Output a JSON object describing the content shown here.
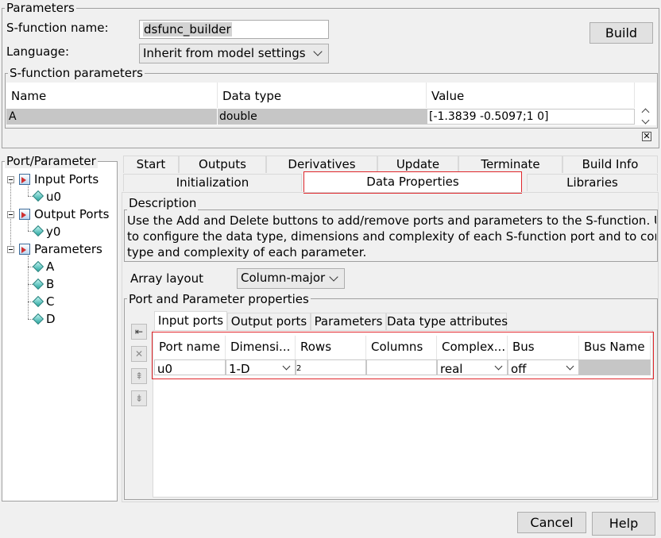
{
  "parameters_group": {
    "title": "Parameters",
    "sfunction_name_label": "S-function name:",
    "sfunction_name_value": "dsfunc_builder",
    "language_label": "Language:",
    "language_value": "Inherit from model settings",
    "build_label": "Build"
  },
  "sfunction_params": {
    "title": "S-function parameters",
    "columns": [
      "Name",
      "Data type",
      "Value"
    ],
    "rows": [
      {
        "name": "A",
        "data_type": "double",
        "value": "[-1.3839 -0.5097;1 0]"
      }
    ]
  },
  "port_tree": {
    "title": "Port/Parameter",
    "input_ports_label": "Input Ports",
    "input_ports": [
      "u0"
    ],
    "output_ports_label": "Output Ports",
    "output_ports": [
      "y0"
    ],
    "parameters_label": "Parameters",
    "parameters": [
      "A",
      "B",
      "C",
      "D"
    ]
  },
  "tabs": {
    "row1": [
      "Start",
      "Outputs",
      "Derivatives",
      "Update",
      "Terminate",
      "Build Info"
    ],
    "row2": [
      "Initialization",
      "Data Properties",
      "Libraries"
    ],
    "selected": "Data Properties"
  },
  "description": {
    "title": "Description",
    "lines": [
      "Use the Add and Delete buttons to add/remove ports and parameters to the S-function. Use",
      "to configure the data type, dimensions and complexity of each S-function port and to config",
      "type and complexity of each parameter."
    ]
  },
  "array_layout": {
    "label": "Array layout",
    "value": "Column-major"
  },
  "pp_properties": {
    "title": "Port and Parameter properties",
    "subtabs": [
      "Input ports",
      "Output ports",
      "Parameters",
      "Data type attributes"
    ],
    "columns": [
      "Port name",
      "Dimensi...",
      "Rows",
      "Columns",
      "Complex...",
      "Bus",
      "Bus Name"
    ],
    "rows": [
      {
        "port_name": "u0",
        "dimensions": "1-D",
        "rows": "2",
        "columns": "",
        "complexity": "real",
        "bus": "off",
        "bus_name": ""
      }
    ]
  },
  "footer": {
    "cancel_label": "Cancel",
    "help_label": "Help"
  },
  "colors": {
    "highlight_red": "#e0262b",
    "selected_row": "#d3d3d3"
  }
}
